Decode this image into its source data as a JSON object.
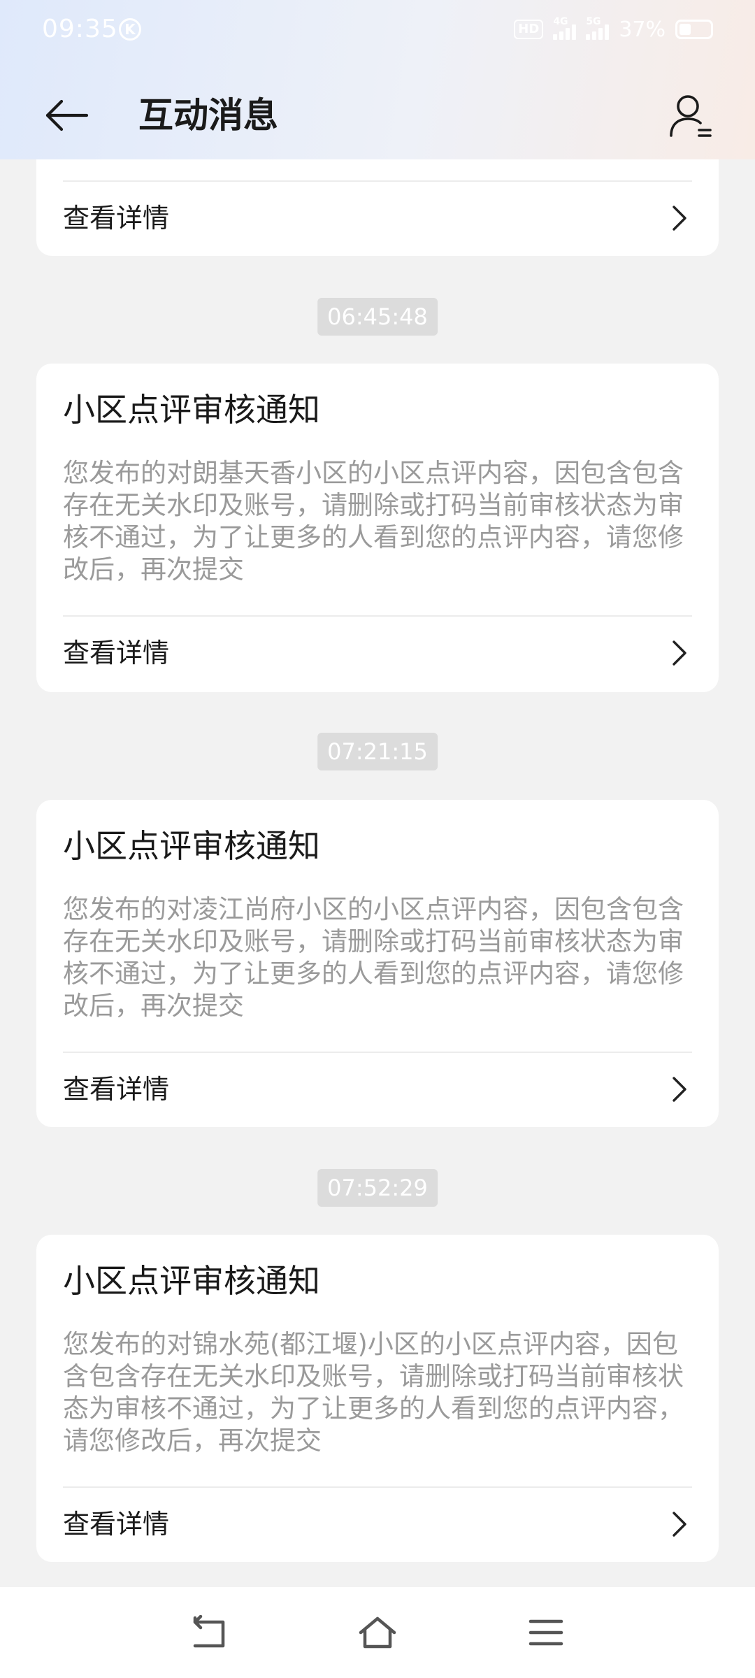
{
  "status_bar": {
    "time": "09:35",
    "k_badge": "K",
    "hd_label": "HD",
    "net_4g": "4G",
    "net_5g": "5G",
    "battery_percent": "37%",
    "battery_level": 0.37
  },
  "header": {
    "title": "互动消息"
  },
  "top_card": {
    "detail_label": "查看详情"
  },
  "messages": [
    {
      "time": "06:45:48",
      "title": "小区点评审核通知",
      "body": "您发布的对朗基天香小区的小区点评内容，因包含包含存在无关水印及账号，请删除或打码当前审核状态为审核不通过，为了让更多的人看到您的点评内容，请您修改后，再次提交",
      "detail_label": "查看详情"
    },
    {
      "time": "07:21:15",
      "title": "小区点评审核通知",
      "body": "您发布的对凌江尚府小区的小区点评内容，因包含包含存在无关水印及账号，请删除或打码当前审核状态为审核不通过，为了让更多的人看到您的点评内容，请您修改后，再次提交",
      "detail_label": "查看详情"
    },
    {
      "time": "07:52:29",
      "title": "小区点评审核通知",
      "body": "您发布的对锦水苑(都江堰)小区的小区点评内容，因包含包含存在无关水印及账号，请删除或打码当前审核状态为审核不通过，为了让更多的人看到您的点评内容，请您修改后，再次提交",
      "detail_label": "查看详情"
    }
  ],
  "colors": {
    "page_bg": "#f2f2f2",
    "card_bg": "#ffffff",
    "title_text": "#1a1a1a",
    "body_text": "#9a9a9a",
    "timestamp_bg": "#dcdcdc"
  }
}
